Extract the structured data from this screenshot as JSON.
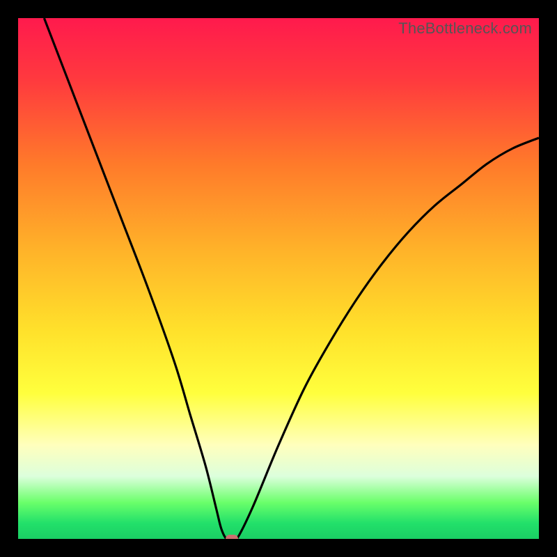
{
  "watermark": "TheBottleneck.com",
  "colors": {
    "frame": "#000000",
    "curve_stroke": "#000000",
    "marker": "#cc6e70",
    "gradient_top": "#ff1a4d",
    "gradient_bottom": "#1ace64"
  },
  "chart_data": {
    "type": "line",
    "title": "",
    "xlabel": "",
    "ylabel": "",
    "xlim": [
      0,
      100
    ],
    "ylim": [
      0,
      100
    ],
    "series": [
      {
        "name": "bottleneck-curve",
        "x": [
          5,
          10,
          15,
          20,
          25,
          30,
          33,
          36,
          38,
          39,
          40,
          41,
          42,
          45,
          50,
          55,
          60,
          65,
          70,
          75,
          80,
          85,
          90,
          95,
          100
        ],
        "y": [
          100,
          87,
          74,
          61,
          48,
          34,
          24,
          14,
          6,
          2,
          0,
          0,
          0,
          6,
          18,
          29,
          38,
          46,
          53,
          59,
          64,
          68,
          72,
          75,
          77
        ]
      }
    ],
    "marker": {
      "x": 41,
      "y": 0
    },
    "gradient_stops": [
      {
        "pct": 0,
        "hex": "#ff1a4d"
      },
      {
        "pct": 12,
        "hex": "#ff3a3e"
      },
      {
        "pct": 28,
        "hex": "#ff7a2a"
      },
      {
        "pct": 45,
        "hex": "#ffb429"
      },
      {
        "pct": 60,
        "hex": "#ffe12b"
      },
      {
        "pct": 72,
        "hex": "#ffff3d"
      },
      {
        "pct": 82,
        "hex": "#ffffbd"
      },
      {
        "pct": 88,
        "hex": "#dcffdc"
      },
      {
        "pct": 93,
        "hex": "#6aff6a"
      },
      {
        "pct": 97,
        "hex": "#22e06a"
      },
      {
        "pct": 100,
        "hex": "#1ace64"
      }
    ]
  }
}
